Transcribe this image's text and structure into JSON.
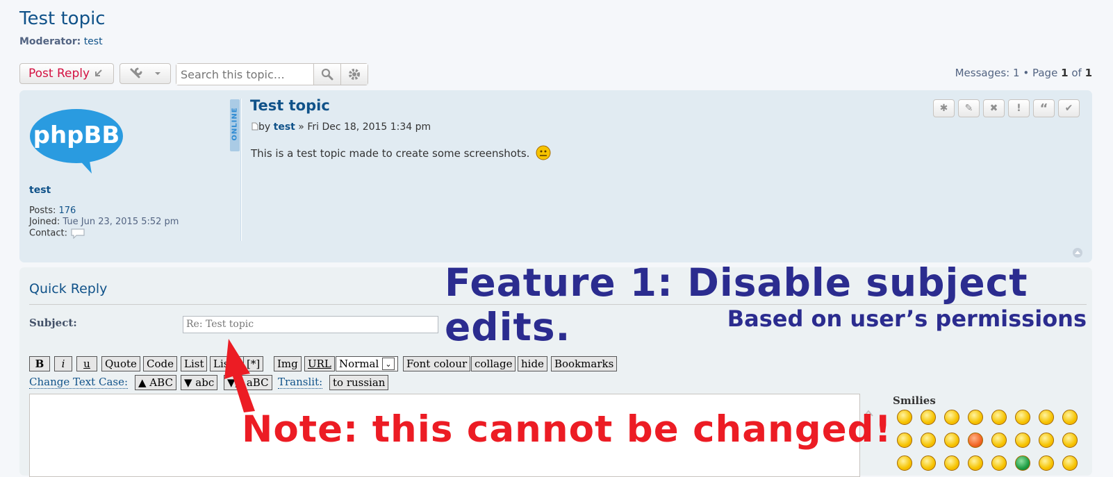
{
  "topic": {
    "title": "Test topic",
    "moderator_label": "Moderator:",
    "moderator_name": "test"
  },
  "actions": {
    "post_reply": "Post Reply",
    "search_placeholder": "Search this topic…"
  },
  "pagination": {
    "messages_label": "Messages:",
    "messages": "1",
    "sep": "•",
    "page_label": "Page",
    "page": "1",
    "of_label": "of",
    "total": "1"
  },
  "post": {
    "status": "ONLINE",
    "title": "Test topic",
    "by": "by",
    "author": "test",
    "date": "» Fri Dec 18, 2015 1:34 pm",
    "body": "This is a test topic made to create some screenshots.",
    "avatar_text": "phpBB"
  },
  "profile": {
    "username": "test",
    "posts_label": "Posts:",
    "posts": "176",
    "joined_label": "Joined:",
    "joined": "Tue Jun 23, 2015 5:52 pm",
    "contact_label": "Contact:"
  },
  "quick_reply": {
    "title": "Quick Reply",
    "subject_label": "Subject:",
    "subject_value": "Re: Test topic"
  },
  "bbcode": {
    "row1": [
      "B",
      "i",
      "u",
      "Quote",
      "Code",
      "List",
      "List=",
      "[*]",
      "Img",
      "URL",
      "Normal",
      "Font colour",
      "collage",
      "hide",
      "Bookmarks"
    ],
    "change_case": "Change Text Case:",
    "upper": "▲ ABC",
    "lower": "▼ abc",
    "mixed": "▼▲ aBC",
    "translit": "Translit:",
    "to_russian": "to russian"
  },
  "smilies_label": "Smilies",
  "annotations": {
    "feature": "Feature 1: Disable subject edits.",
    "feature_sub": "Based on user’s permissions",
    "note": "Note: this cannot be changed!"
  },
  "colors": {
    "brand_blue": "#105289",
    "annotation_blue": "#2b2c8f",
    "annotation_red": "#ec1c24",
    "post_bg": "#e1ebf2"
  }
}
